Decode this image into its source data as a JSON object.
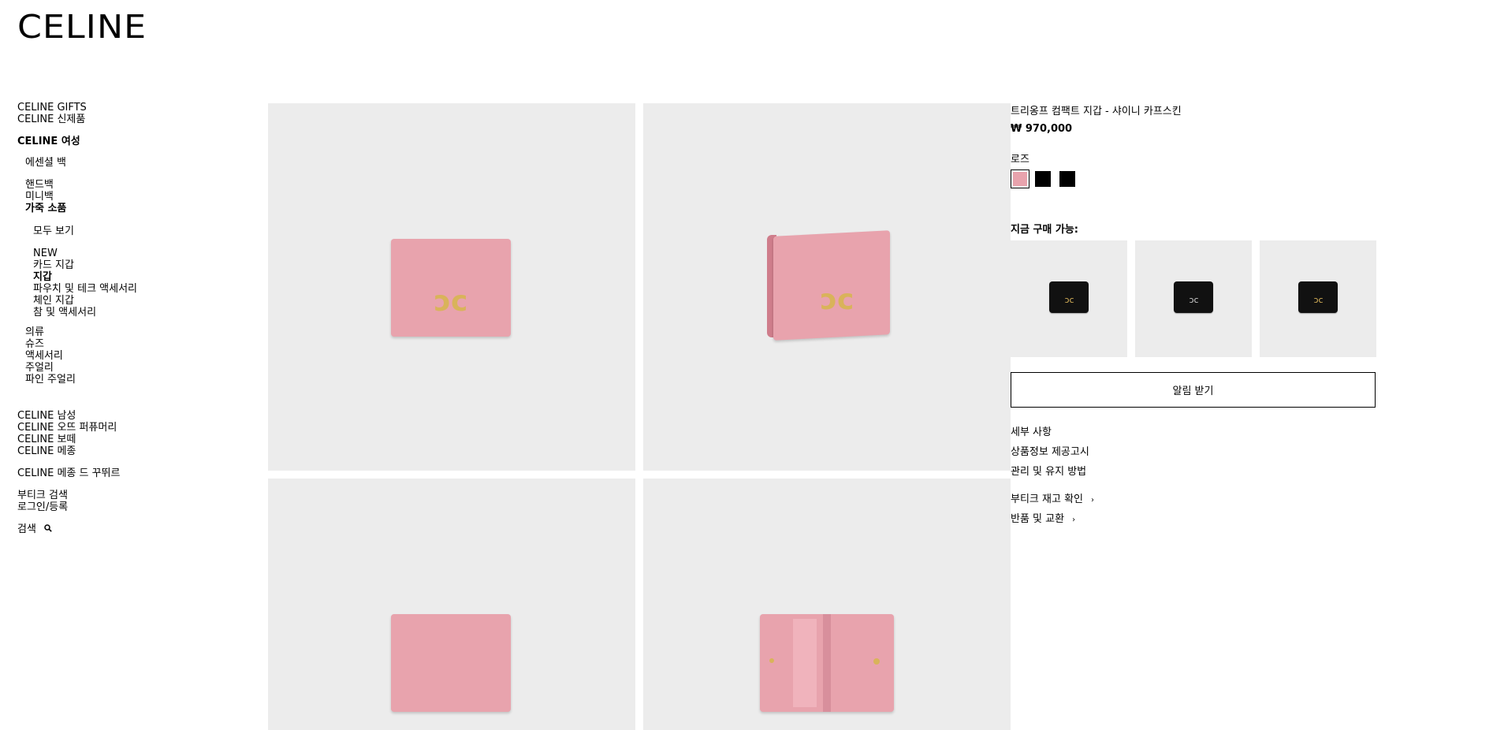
{
  "brand": {
    "logo": "CELINE"
  },
  "sidebar": {
    "items": [
      {
        "label": "CELINE GIFTS"
      },
      {
        "label": "CELINE 신제품"
      },
      {
        "label": "CELINE 여성"
      },
      {
        "label": "에센셜 백"
      },
      {
        "label": "핸드백"
      },
      {
        "label": "미니백"
      },
      {
        "label": "가죽 소품"
      },
      {
        "label": "모두 보기"
      },
      {
        "label": "NEW"
      },
      {
        "label": "카드 지갑"
      },
      {
        "label": "지갑"
      },
      {
        "label": "파우치 및 테크 액세서리"
      },
      {
        "label": "체인 지갑"
      },
      {
        "label": "참 및 액세서리"
      },
      {
        "label": "의류"
      },
      {
        "label": "슈즈"
      },
      {
        "label": "액세서리"
      },
      {
        "label": "주얼리"
      },
      {
        "label": "파인 주얼리"
      },
      {
        "label": "CELINE 남성"
      },
      {
        "label": "CELINE 오뜨 퍼퓨머리"
      },
      {
        "label": "CELINE 보떼"
      },
      {
        "label": "CELINE 메종"
      },
      {
        "label": "CELINE 메종 드 꾸뛰르"
      },
      {
        "label": "부티크 검색"
      },
      {
        "label": "로그인/등록"
      },
      {
        "label": "검색"
      }
    ]
  },
  "product": {
    "title": "트리옹프 컴팩트 지갑 - 샤이니 카프스킨",
    "price": "₩ 970,000",
    "color_label": "로즈",
    "swatches": [
      "#e8a3ad",
      "#000000",
      "#000000"
    ],
    "available_label": "지금 구매 가능:",
    "notify_label": "알림 받기",
    "details_label": "세부 사항",
    "info_notice_label": "상품정보 제공고시",
    "care_label": "관리 및 유지 방법",
    "stock_label": "부티크 재고 확인",
    "returns_label": "반품 및 교환"
  },
  "icons": {
    "search": "search-icon",
    "chevron": "chevron-right-icon"
  },
  "colors": {
    "wallet_pink": "#e8a3ad",
    "wallet_pink_dark": "#cf7d8b",
    "clasp_gold": "#d9b35a",
    "tile_bg": "#ececec"
  }
}
